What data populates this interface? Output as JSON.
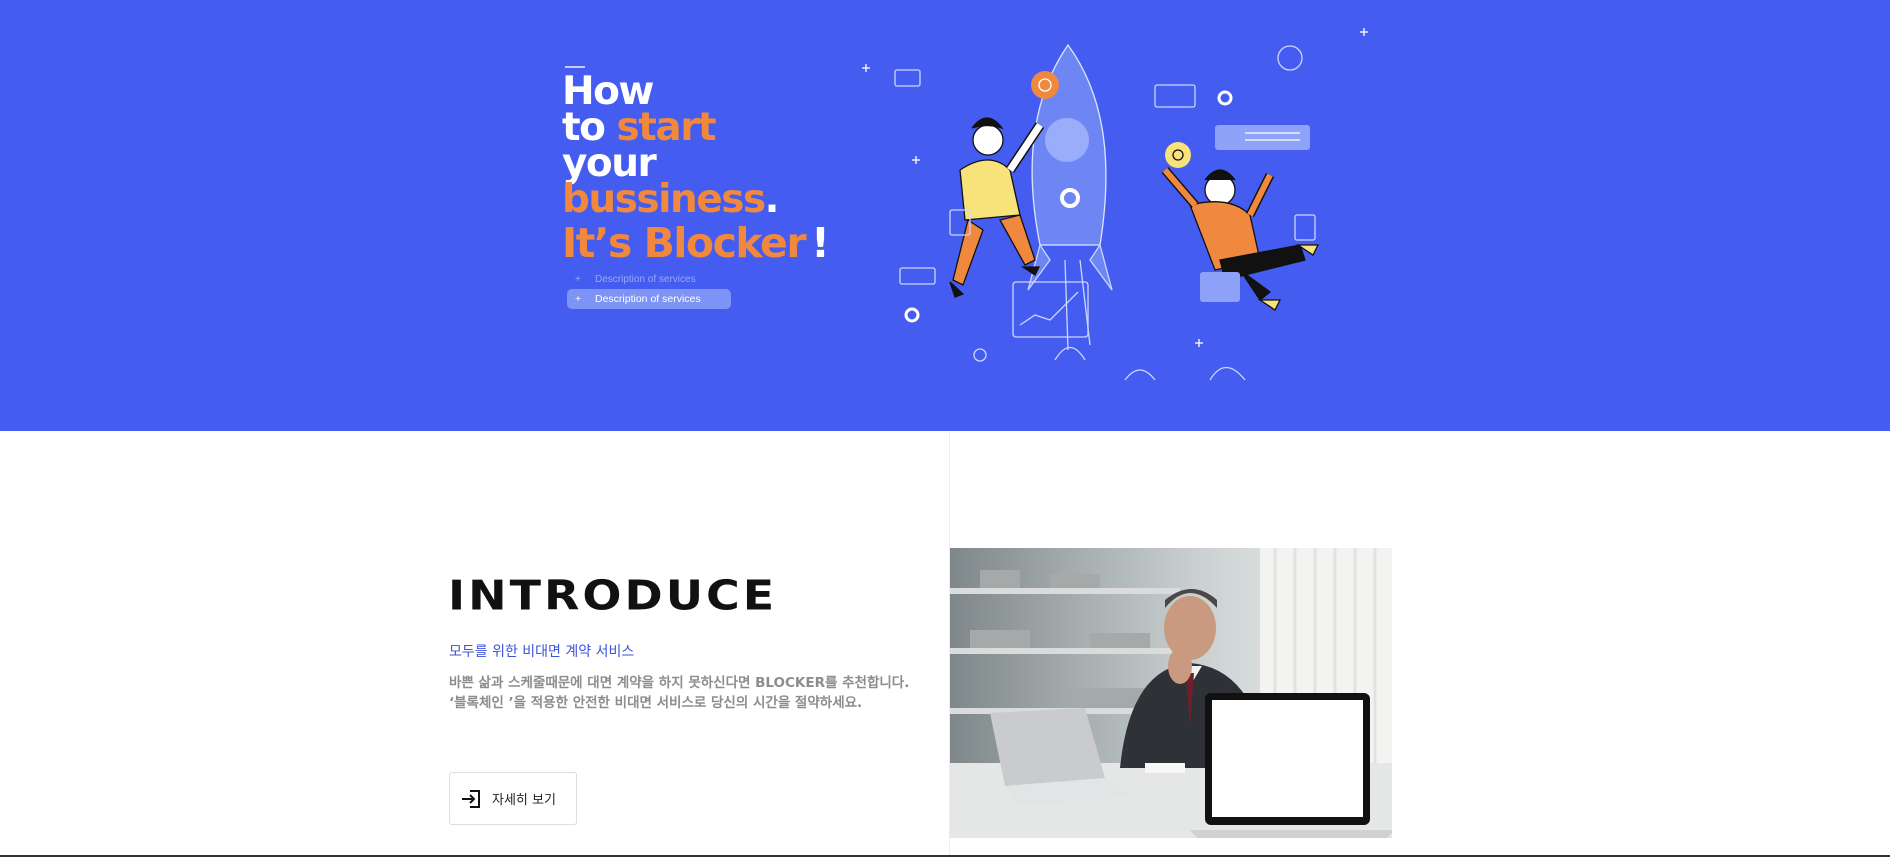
{
  "hero": {
    "headline": {
      "line1": "How",
      "line2_prefix": "to ",
      "line2_highlight": "start",
      "line3": "your",
      "line4_highlight": "bussiness",
      "line4_suffix": ".",
      "line5_highlight": "It’s Blocker",
      "line5_suffix": "!"
    },
    "services": [
      {
        "plus": "+",
        "label": "Description of services"
      },
      {
        "plus": "+",
        "label": "Description of services"
      }
    ],
    "background_color": "#445df0",
    "accent_color": "#f0883e"
  },
  "introduce": {
    "title": "INTRODUCE",
    "subtitle": "모두를 위한 비대면 계약 서비스",
    "description": "바쁜 삶과 스케줄때문에 대면 계약을 하지 못하신다면 BLOCKER를 추천합니다. ‘블록체인 ’을 적용한 안전한 비대면 서비스로 당신의 시간을 절약하세요.",
    "more_button": {
      "icon": "login-arrow-icon",
      "label": "자세히 보기"
    }
  }
}
